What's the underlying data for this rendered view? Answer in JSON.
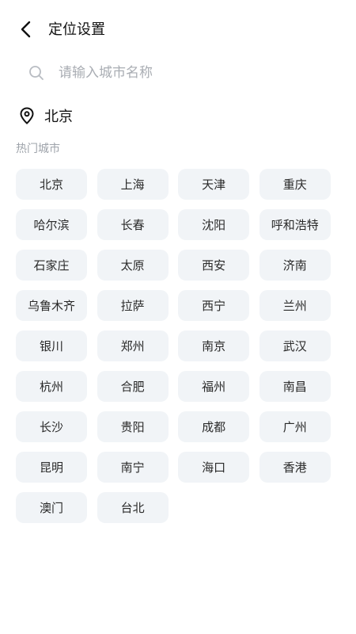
{
  "header": {
    "title": "定位设置",
    "back_icon": "chevron-left-icon"
  },
  "search": {
    "placeholder": "请输入城市名称",
    "value": "",
    "icon": "search-icon"
  },
  "current_location": {
    "icon": "map-pin-icon",
    "city": "北京"
  },
  "hot_cities": {
    "label": "热门城市",
    "cities": [
      "北京",
      "上海",
      "天津",
      "重庆",
      "哈尔滨",
      "长春",
      "沈阳",
      "呼和浩特",
      "石家庄",
      "太原",
      "西安",
      "济南",
      "乌鲁木齐",
      "拉萨",
      "西宁",
      "兰州",
      "银川",
      "郑州",
      "南京",
      "武汉",
      "杭州",
      "合肥",
      "福州",
      "南昌",
      "长沙",
      "贵阳",
      "成都",
      "广州",
      "昆明",
      "南宁",
      "海口",
      "香港",
      "澳门",
      "台北"
    ]
  },
  "colors": {
    "button_bg": "#f1f4f7",
    "label_gray": "#9ea3aa",
    "placeholder_gray": "#a9adb3"
  }
}
